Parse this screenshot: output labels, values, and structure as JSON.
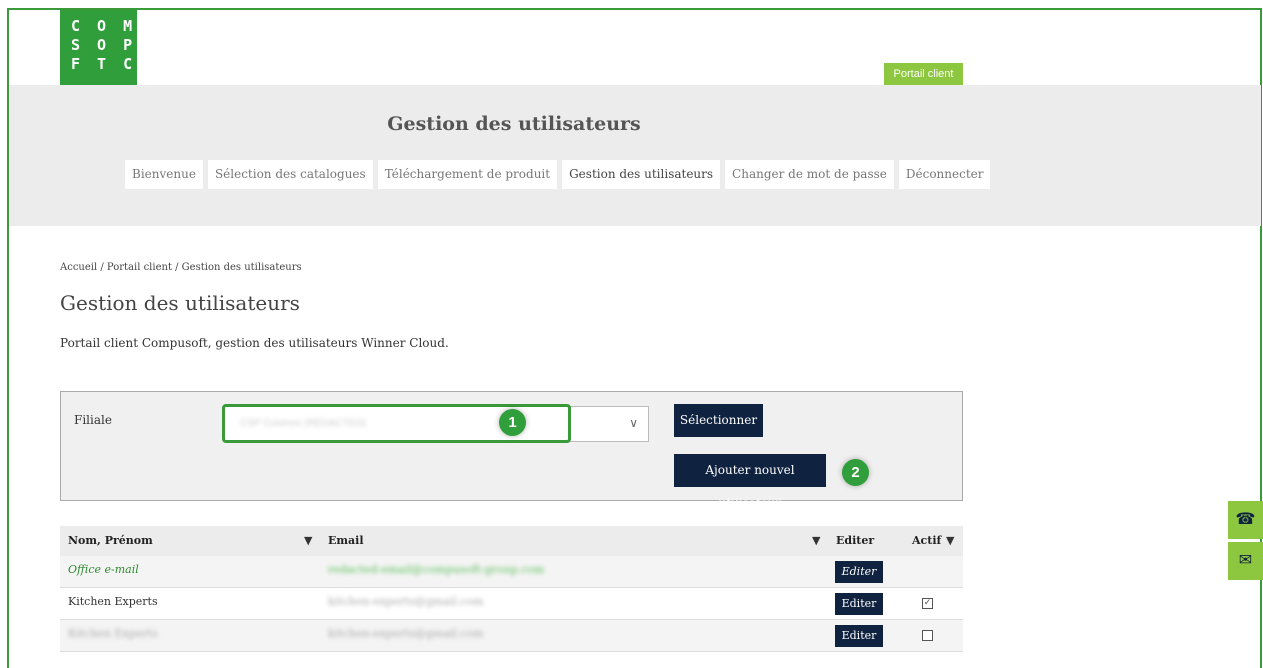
{
  "logo": {
    "line1": "C O M",
    "line2": "S O P",
    "line3": "F T C"
  },
  "portal_tag": "Portail client",
  "header": {
    "title": "Gestion des utilisateurs"
  },
  "nav": [
    {
      "label": "Bienvenue"
    },
    {
      "label": "Sélection des catalogues"
    },
    {
      "label": "Téléchargement de produit"
    },
    {
      "label": "Gestion des utilisateurs"
    },
    {
      "label": "Changer de mot de passe"
    },
    {
      "label": "Déconnecter"
    }
  ],
  "breadcrumb": "Accueil  /  Portail client  /  Gestion des utilisateurs",
  "page_title": "Gestion des utilisateurs",
  "intro": "Portail client Compusoft, gestion des utilisateurs Winner Cloud.",
  "filter": {
    "label": "Filiale",
    "selected": "CSP Cuisines (REDACTED)",
    "select_button": "Sélectionner",
    "add_button": "Ajouter nouvel utilisateur"
  },
  "badges": {
    "one": "1",
    "two": "2"
  },
  "table": {
    "headers": {
      "name": "Nom, Prénom",
      "email": "Email",
      "edit": "Editer",
      "active": "Actif"
    },
    "rows": [
      {
        "name": "Office e-mail",
        "email": "redacted-email@compusoft-group.com",
        "edit": "Editer",
        "active": ""
      },
      {
        "name": "Kitchen Experts",
        "email": "kitchen-experts@gmail.com",
        "edit": "Editer",
        "active": "✓"
      },
      {
        "name": "Kitchen Experts",
        "email": "kitchen-experts@gmail.com",
        "edit": "Editer",
        "active": ""
      }
    ]
  },
  "side": {
    "phone_icon": "phone-icon",
    "mail_icon": "mail-icon"
  },
  "colors": {
    "brand_green": "#2f9e3b",
    "lime": "#8dc63f",
    "navy": "#0f2240"
  }
}
